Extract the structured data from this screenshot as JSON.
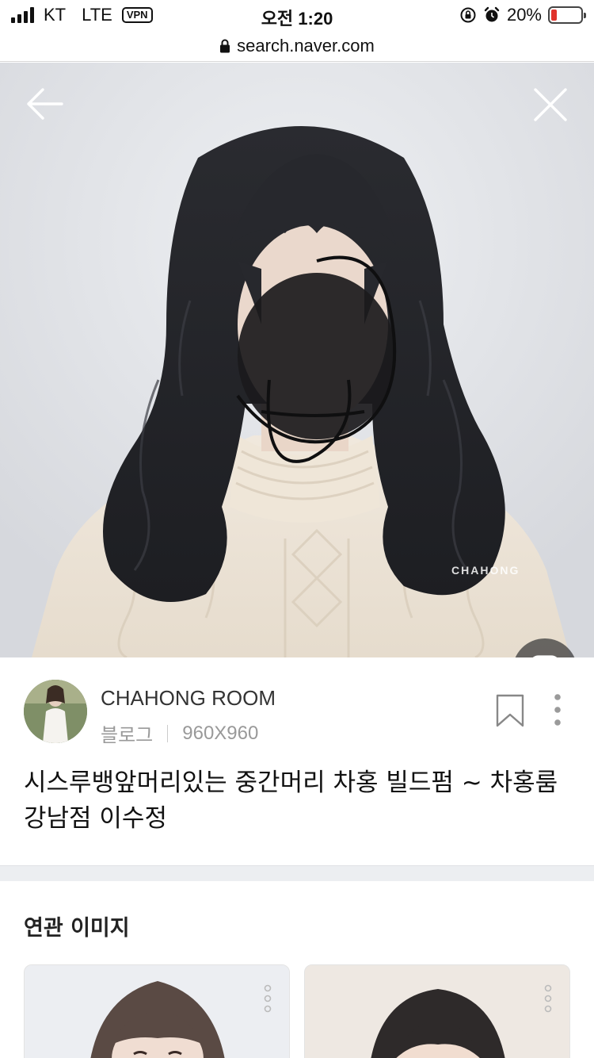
{
  "status_bar": {
    "carrier": "KT",
    "network": "LTE",
    "vpn": "VPN",
    "time": "오전 1:20",
    "battery": "20%",
    "battery_level": 0.2,
    "battery_color": "#e0322b",
    "icons": [
      "signal-icon",
      "rotation-lock-icon",
      "alarm-icon",
      "battery-icon"
    ]
  },
  "url_bar": {
    "url": "search.naver.com",
    "icon": "lock-icon"
  },
  "viewer": {
    "back_icon": "back-arrow-icon",
    "close_icon": "close-icon",
    "watermark": "CHAHONG",
    "lens_icon": "lens-search-icon"
  },
  "info": {
    "source_name": "CHAHONG ROOM",
    "source_type": "블로그",
    "dimensions": "960X960",
    "title": "시스루뱅앞머리있는 중간머리 차홍 빌드펌 ~ 차홍룸 강남점 이수정",
    "bookmark_icon": "bookmark-icon",
    "more_icon": "more-vertical-icon"
  },
  "related": {
    "title": "연관 이미지"
  }
}
